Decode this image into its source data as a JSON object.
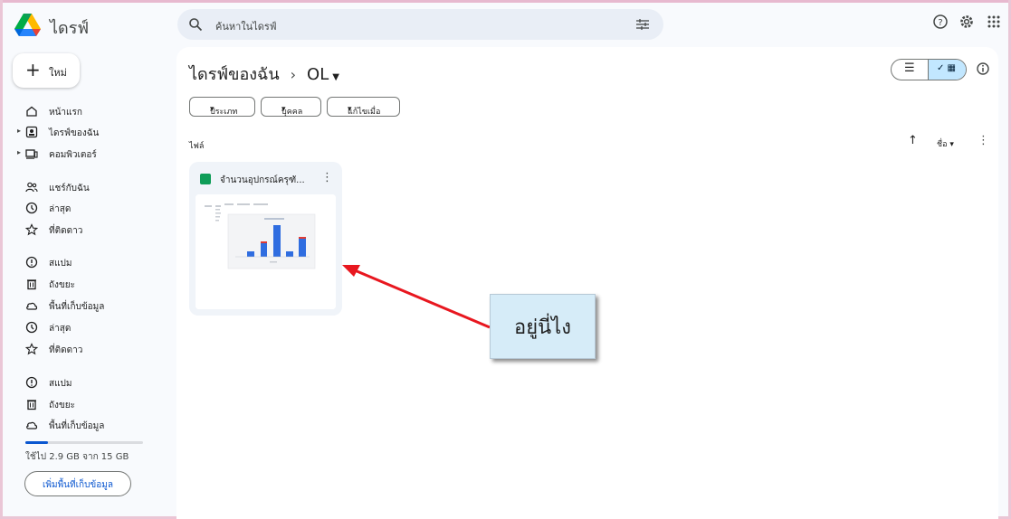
{
  "header": {
    "app_title": "ไดรฟ์",
    "search_placeholder": "ค้นหาในไดรฟ์"
  },
  "sidebar": {
    "new_label": "ใหม่",
    "items": [
      {
        "label": "หน้าแรก",
        "icon": "home-icon"
      },
      {
        "label": "ไดรฟ์ของฉัน",
        "icon": "my-drive-icon"
      },
      {
        "label": "คอมพิวเตอร์",
        "icon": "computer-icon"
      },
      {
        "label": "แชร์กับฉัน",
        "icon": "shared-icon"
      },
      {
        "label": "ล่าสุด",
        "icon": "clock-icon"
      },
      {
        "label": "ที่ติดดาว",
        "icon": "star-icon"
      },
      {
        "label": "สแปม",
        "icon": "spam-icon"
      },
      {
        "label": "ถังขยะ",
        "icon": "trash-icon"
      },
      {
        "label": "พื้นที่เก็บข้อมูล",
        "icon": "cloud-icon"
      },
      {
        "label": "ล่าสุด",
        "icon": "clock-icon"
      },
      {
        "label": "ที่ติดดาว",
        "icon": "star-icon"
      },
      {
        "label": "สแปม",
        "icon": "spam-icon"
      },
      {
        "label": "ถังขยะ",
        "icon": "trash-icon"
      },
      {
        "label": "พื้นที่เก็บข้อมูล",
        "icon": "cloud-icon"
      }
    ],
    "storage_used_fraction": 0.19,
    "storage_text": "ใช้ไป 2.9 GB จาก 15 GB",
    "storage_button": "เพิ่มพื้นที่เก็บข้อมูล"
  },
  "main": {
    "breadcrumb_root": "ไดรฟ์ของฉัน",
    "breadcrumb_sep": "›",
    "breadcrumb_current": "OL",
    "filters": [
      "ประเภท",
      "บุคคล",
      "แก้ไขเมื่อ"
    ],
    "section_label": "ไฟล์",
    "sort_label": "ชื่อ",
    "file": {
      "name": "จำนวนอุปกรณ์ครุฑั..."
    }
  },
  "callout": {
    "text": "อยู่นี่ไง"
  },
  "colors": {
    "accent": "#0b57d0",
    "sheets_green": "#0f9d58",
    "arrow_red": "#e8171f",
    "callout_bg": "#d6ecf8"
  }
}
